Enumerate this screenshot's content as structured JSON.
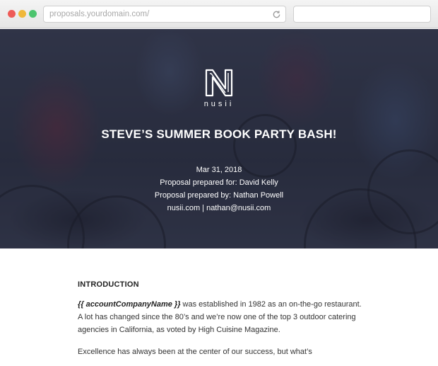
{
  "browser": {
    "url": "proposals.yourdomain.com/",
    "colors": {
      "close": "#ee5b57",
      "minimize": "#f0b83b",
      "maximize": "#4cc46e"
    }
  },
  "hero": {
    "logo_text": "nusii",
    "title": "STEVE’S SUMMER BOOK PARTY BASH!",
    "date": "Mar 31, 2018",
    "prepared_for": "Proposal prepared for: David Kelly",
    "prepared_by": "Proposal prepared by: Nathan Powell",
    "contact": "nusii.com | nathan@nusii.com"
  },
  "body": {
    "section_title": "INTRODUCTION",
    "para1_variable": "{{ accountCompanyName }}",
    "para1_text": " was established in 1982 as an on-the-go restaurant. A lot has changed since the 80’s and we’re now one of the top 3 outdoor catering agencies in California, as voted by High Cuisine Magazine.",
    "para2_text": "Excellence has always been at the center of our success, but what’s"
  }
}
